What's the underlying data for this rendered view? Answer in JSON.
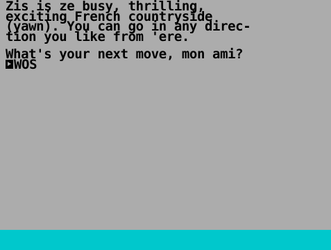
{
  "game": {
    "description_lines": [
      "Zis is ze busy, thrilling,",
      "exciting French countryside",
      "(yawn). You can go in any direc-",
      "tion you like from 'ere."
    ],
    "prompt": "What's your next move, mon ami?",
    "cursor_icon": "prompt-cursor-icon",
    "input_value": "WOS"
  },
  "colors": {
    "background": "#acacac",
    "text": "#000000",
    "status_bar": "#00c8cc"
  }
}
